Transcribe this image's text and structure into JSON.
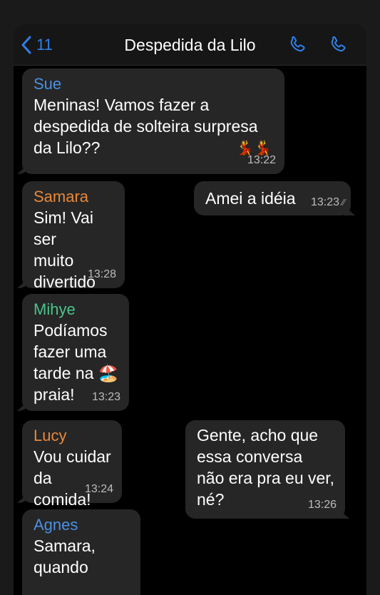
{
  "header": {
    "back_count": "11",
    "title": "Despedida da Lilo",
    "icons": [
      "chevron-left-icon",
      "phone-icon",
      "phone-icon"
    ],
    "accent": "#2f7fe8"
  },
  "messages": [
    {
      "sender": "Sue",
      "sender_color": "#4a90e2",
      "text": "Meninas! Vamos fazer a\ndespedida de solteira surpresa\nda Lilo??",
      "emoji": "💃💃",
      "time": "13:22"
    },
    {
      "sender": "Samara",
      "sender_color": "#e8883a",
      "text": "Sim! Vai ser\nmuito\ndivertido☺️",
      "time": "13:28"
    },
    {
      "text": "Amei a idéia",
      "time": "13:23",
      "status": "read"
    },
    {
      "sender": "Mihye",
      "sender_color": "#4cc38a",
      "text": "Podíamos\nfazer uma\ntarde na 🏖️\npraia!",
      "time": "13:23"
    },
    {
      "sender": "Lucy",
      "sender_color": "#e8883a",
      "text": "Vou cuidar\nda comida!",
      "time": "13:24"
    },
    {
      "text": "Gente, acho que\nessa conversa\nnão era pra eu ver,\nné?",
      "time": "13:26"
    },
    {
      "sender": "Agnes",
      "sender_color": "#4a90e2",
      "text": "Samara,\nquando"
    }
  ]
}
